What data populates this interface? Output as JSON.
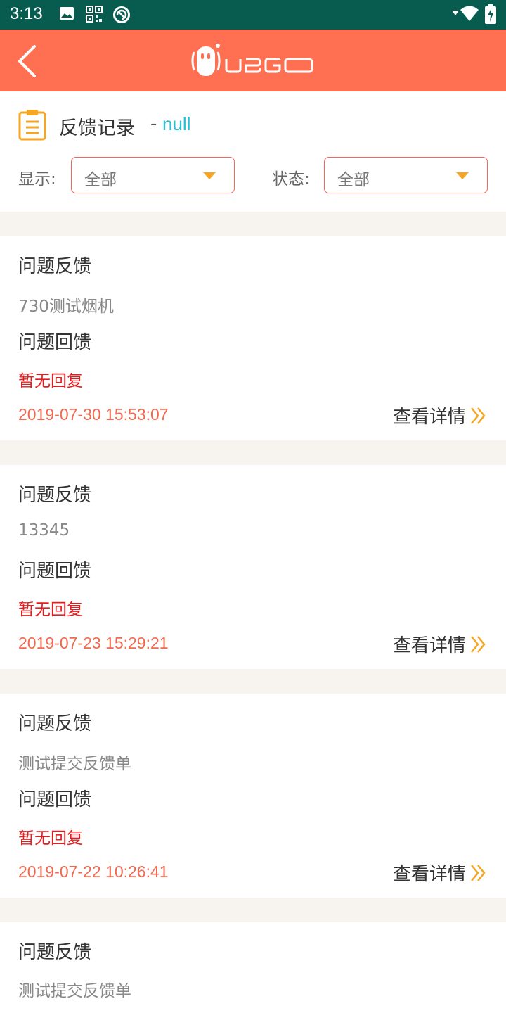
{
  "status_bar": {
    "time": "3:13",
    "icons": [
      "image-icon",
      "qr-code-icon",
      "at-sign-icon",
      "wifi-icon",
      "battery-icon"
    ]
  },
  "app_bar": {
    "back_icon": "chevron-left-icon",
    "logo_text": "UBGO",
    "color": "#ff7052"
  },
  "header": {
    "icon": "clipboard-list-icon",
    "title": "反馈记录",
    "dash": "-",
    "user": "null"
  },
  "filters": {
    "display_label": "显示:",
    "display_value": "全部",
    "status_label": "状态:",
    "status_value": "全部"
  },
  "records": [
    {
      "feedback_heading": "问题反馈",
      "feedback_text": "730测试烟机",
      "reply_heading": "问题回馈",
      "reply_text": "暂无回复",
      "time": "2019-07-30 15:53:07",
      "detail_label": "查看详情"
    },
    {
      "feedback_heading": "问题反馈",
      "feedback_text": "13345",
      "reply_heading": "问题回馈",
      "reply_text": "暂无回复",
      "time": "2019-07-23 15:29:21",
      "detail_label": "查看详情"
    },
    {
      "feedback_heading": "问题反馈",
      "feedback_text": "测试提交反馈单",
      "reply_heading": "问题回馈",
      "reply_text": "暂无回复",
      "time": "2019-07-22 10:26:41",
      "detail_label": "查看详情"
    },
    {
      "feedback_heading": "问题反馈",
      "feedback_text": "测试提交反馈单"
    }
  ],
  "colors": {
    "status_bar": "#075c4f",
    "accent": "#ff7052",
    "no_reply": "#e81c1c",
    "timestamp": "#f2694f",
    "detail_chevron": "#f5a623",
    "user_text": "#2cbfd0"
  }
}
